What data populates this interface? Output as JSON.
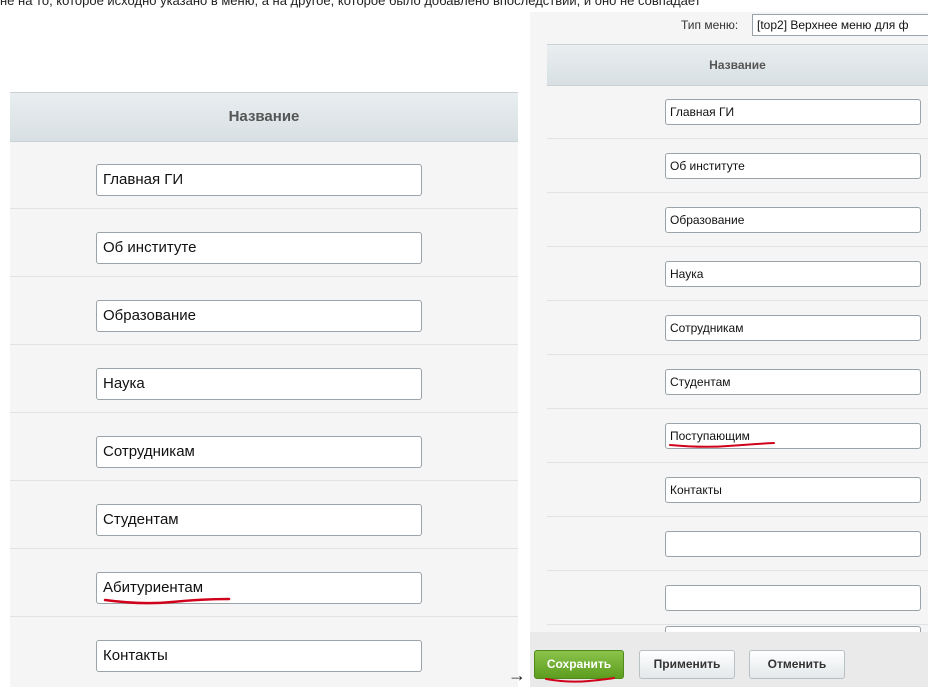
{
  "top_text": "не на то, которое исходно указано в меню, а на другое, которое было добавлено впоследствии, и оно не совпадает",
  "left": {
    "header": "Название",
    "items": [
      "Главная ГИ",
      "Об институте",
      "Образование",
      "Наука",
      "Сотрудникам",
      "Студентам",
      "Абитуриентам",
      "Контакты"
    ]
  },
  "arrow": "→",
  "right": {
    "type_label": "Тип меню:",
    "type_value": "[top2] Верхнее меню для ф",
    "header": "Название",
    "items": [
      "Главная ГИ",
      "Об институте",
      "Образование",
      "Наука",
      "Сотрудникам",
      "Студентам",
      "Поступающим",
      "Контакты",
      "",
      "",
      ""
    ],
    "buttons": {
      "save": "Сохранить",
      "apply": "Применить",
      "cancel": "Отменить"
    }
  },
  "colors": {
    "header_bg": "#dde4e7",
    "save_button": "#6aab2a",
    "annotation_red": "#d0021b"
  }
}
